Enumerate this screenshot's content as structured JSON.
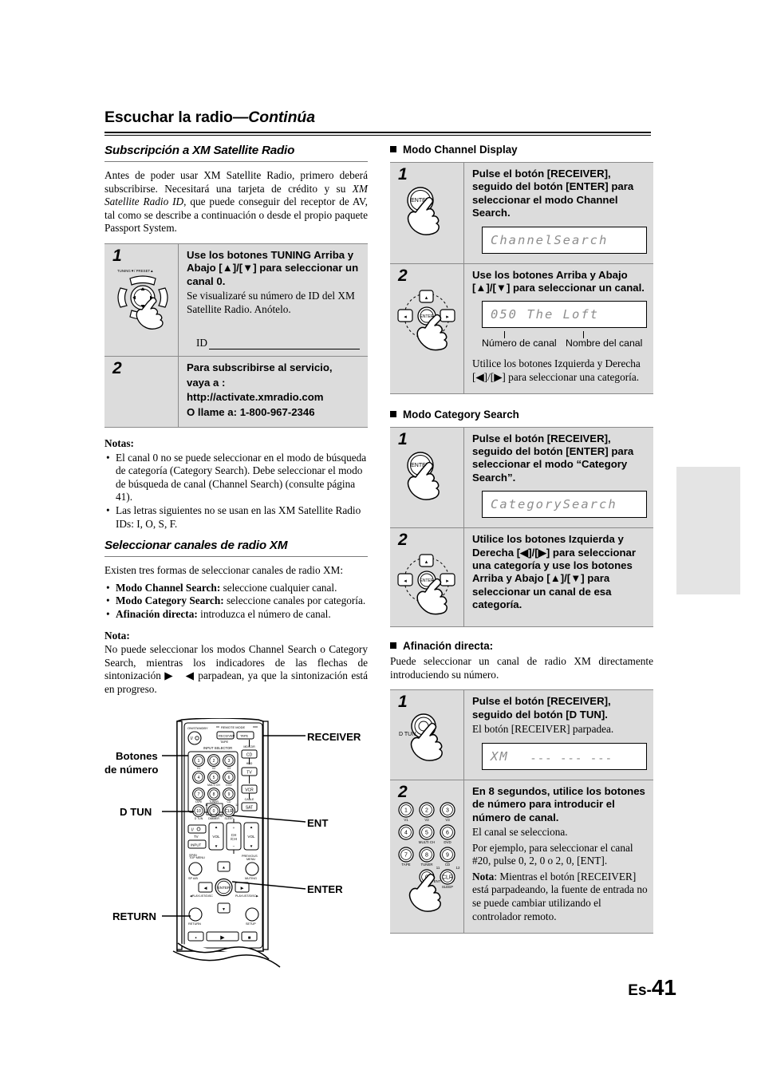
{
  "header": {
    "title_main": "Escuchar la radio",
    "title_dash": "—",
    "title_cont": "Continúa"
  },
  "left": {
    "section1": {
      "heading": "Subscripción a XM Satellite Radio",
      "intro_a": "Antes de poder usar XM Satellite Radio, primero deberá subscribirse. Necesitará una tarjeta de crédito y su ",
      "intro_italic": "XM Satellite Radio ID",
      "intro_b": ", que puede conseguir del receptor de AV, tal como se describe a continuación o desde el propio paquete Passport System.",
      "steps": [
        {
          "num": "1",
          "icon": "tuning-preset-dpad-icon",
          "title": "Use los botones TUNING Arriba y Abajo [▲]/[▼] para seleccionar un canal  0.",
          "sub": "Se visualizaré su número de ID del XM Satellite Radio. Anótelo.",
          "id_label": "ID"
        },
        {
          "num": "2",
          "title_line1": "Para subscribirse al servicio,",
          "title_line2": "vaya a :",
          "title_line3": "http://activate.xmradio.com",
          "title_line4": "O llame a: 1-800-967-2346"
        }
      ],
      "notes_label": "Notas:",
      "notes": [
        "El canal 0 no se puede seleccionar en el modo de búsqueda de categoría (Category Search). Debe seleccionar el modo de búsqueda de canal (Channel Search) (consulte página 41).",
        "Las letras siguientes no se usan en las XM Satellite Radio IDs: I, O, S, F."
      ]
    },
    "section2": {
      "heading": "Seleccionar canales de radio XM",
      "intro": "Existen tres formas de seleccionar canales de radio XM:",
      "bullets": [
        {
          "bold": "Modo Channel Search:",
          "rest": " seleccione cualquier canal."
        },
        {
          "bold": "Modo Category Search:",
          "rest": " seleccione canales por categoría."
        },
        {
          "bold": "Afinación directa:",
          "rest": " introduzca el número de canal."
        }
      ],
      "note_label": "Nota:",
      "note_a": "No puede seleccionar los modos Channel Search o Category Search, mientras los indicadores de las flechas de sintonización ",
      "note_arrow_right": "▶",
      "note_arrow_left": "◀",
      "note_b": " parpadean, ya que la sintonización está en progreso."
    },
    "figure": {
      "name": "remote-control-diagram",
      "labels": {
        "receiver": "RECEIVER",
        "botones_de_numero_l1": "Botones",
        "botones_de_numero_l2": "de número",
        "d_tun": "D TUN",
        "ent": "ENT",
        "enter": "ENTER",
        "return": "RETURN"
      },
      "remote_keys": {
        "on_standby": "ON/STANDBY",
        "remote_mode": "REMOTE MODE",
        "receiver_key": "RECEIVER",
        "tape_key": "TAPE",
        "input_selector": "INPUT SELECTOR",
        "md_cdr": "MD/CDR",
        "cd": "CD",
        "hdd": "HDD",
        "tv": "TV",
        "vcr": "VCR",
        "cable": "CABLE",
        "sat": "SAT",
        "vol": "VOL",
        "input": "INPUT",
        "sp_ab": "SP A/B",
        "muting": "MUTING",
        "setup": "SETUP",
        "return_key": "RETURN",
        "enter_key": "ENTER",
        "ch": "CH",
        "numbers": [
          "1",
          "2",
          "3",
          "4",
          "5",
          "6",
          "7",
          "8",
          "9",
          "10",
          "0",
          "CLR"
        ],
        "sublabels": [
          "V1",
          "V2",
          "V3",
          "",
          "MULTI CH",
          "DVD",
          "TAPE",
          "TUNER",
          "CD",
          "D TUN",
          "DIMMER",
          "SLEEP"
        ]
      }
    }
  },
  "right": {
    "channel_display": {
      "heading": "Modo Channel Display",
      "steps": [
        {
          "num": "1",
          "icon": "enter-button-press-icon",
          "title": "Pulse el botón [RECEIVER], seguido del botón [ENTER] para seleccionar el modo Channel Search.",
          "lcd": "ChannelSearch"
        },
        {
          "num": "2",
          "icon": "dpad-enter-press-icon",
          "title": "Use los botones Arriba y Abajo [▲]/[▼] para seleccionar un canal.",
          "lcd": "050 The Loft",
          "callout_left": "Número de canal",
          "callout_right": "Nombre del canal",
          "sub": "Utilice los botones Izquierda y Derecha [◀]/[▶] para seleccionar una categoría."
        }
      ]
    },
    "category_search": {
      "heading": "Modo Category Search",
      "steps": [
        {
          "num": "1",
          "icon": "enter-button-press-icon",
          "title": "Pulse el botón [RECEIVER], seguido del botón [ENTER] para seleccionar el modo “Category Search”.",
          "lcd": "CategorySearch"
        },
        {
          "num": "2",
          "icon": "dpad-enter-press-icon",
          "title": "Utilice los botones Izquierda y Derecha [◀]/[▶] para seleccionar una categoría y use los botones Arriba y Abajo [▲]/[▼] para seleccionar un canal de esa categoría."
        }
      ]
    },
    "direct_tuning": {
      "heading": "Afinación directa:",
      "intro": "Puede seleccionar un canal de radio XM directamente introduciendo su número.",
      "steps": [
        {
          "num": "1",
          "icon": "d-tun-button-press-icon",
          "title": "Pulse el botón [RECEIVER], seguido del botón [D TUN].",
          "sub": "El botón [RECEIVER] parpadea.",
          "lcd": "XM",
          "lcd_dashes": "--- --- ---"
        },
        {
          "num": "2",
          "icon": "numeric-keypad-press-icon",
          "title": "En 8 segundos, utilice los botones de número para introducir el número de canal.",
          "sub1": "El canal se selecciona.",
          "sub2": "Por ejemplo, para seleccionar el canal #20, pulse 0, 2, 0 o 2, 0, [ENT].",
          "note_bold": "Nota",
          "note_rest": ": Mientras el botón [RECEIVER] está parpadeando, la fuente de entrada no se puede cambiar utilizando el controlador remoto.",
          "keypad": {
            "keys": [
              "1",
              "2",
              "3",
              "4",
              "5",
              "6",
              "7",
              "8",
              "9",
              "0",
              "CLR"
            ],
            "sublabels": [
              "V1",
              "V2",
              "V3",
              "",
              "MULTI CH",
              "DVD",
              "TAPE",
              "TUNER",
              "CD",
              "DIMMER",
              "SLEEP"
            ],
            "small_11": "11",
            "small_12": "12",
            "small_ent": "ENT"
          }
        }
      ]
    }
  },
  "footer": {
    "page_prefix": "Es-",
    "page_number": "41"
  },
  "colors": {
    "step_bg": "#dcdcdc",
    "rule": "#8a8a8a",
    "lcd_text": "#8d8d8d",
    "edge_tab": "#e4e4e4"
  }
}
